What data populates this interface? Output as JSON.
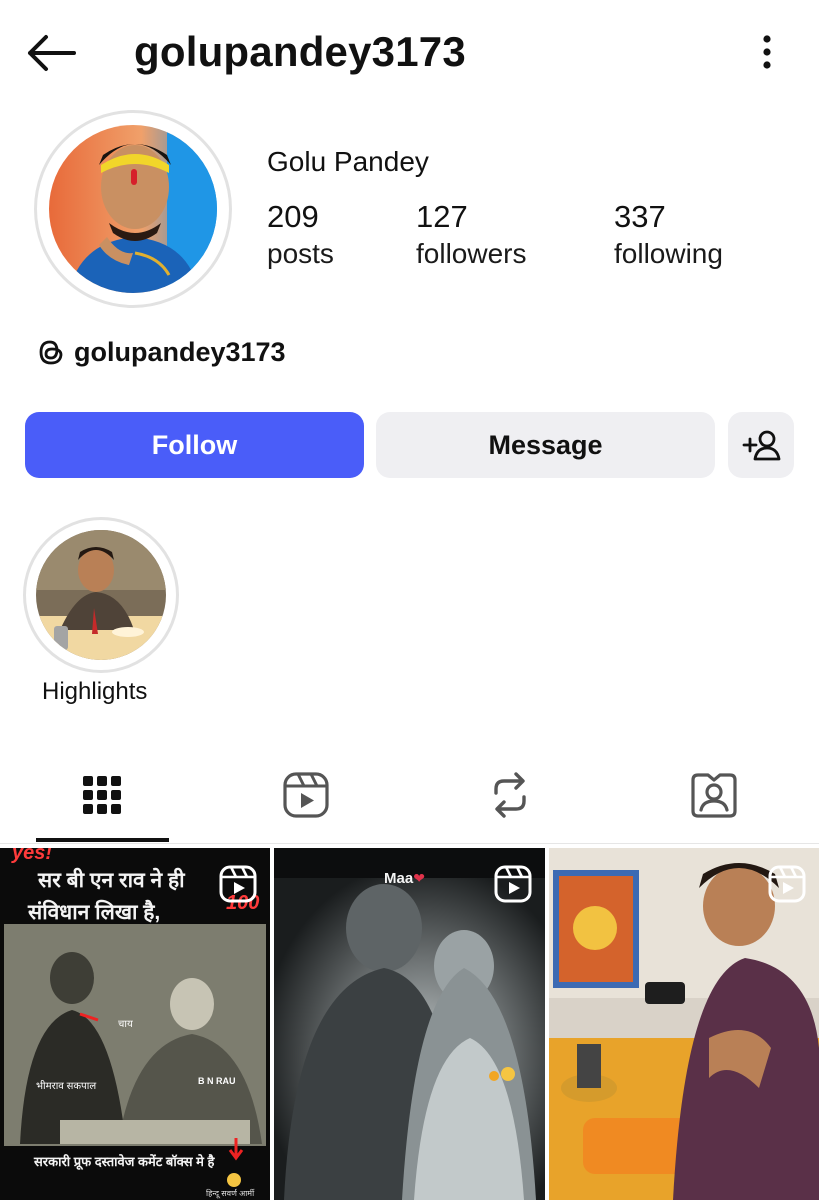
{
  "header": {
    "username": "golupandey3173",
    "back_icon": "arrow-left-icon",
    "more_icon": "vertical-dots-icon"
  },
  "profile": {
    "display_name": "Golu Pandey",
    "stats": {
      "posts": {
        "value": "209",
        "label": "posts"
      },
      "followers": {
        "value": "127",
        "label": "followers"
      },
      "following": {
        "value": "337",
        "label": "following"
      }
    },
    "threads_handle": "golupandey3173"
  },
  "actions": {
    "follow_label": "Follow",
    "message_label": "Message",
    "add_user_icon": "add-person-icon"
  },
  "highlights": [
    {
      "label": "Highlights"
    }
  ],
  "tabs": [
    {
      "icon": "grid-icon",
      "active": true
    },
    {
      "icon": "reels-icon",
      "active": false
    },
    {
      "icon": "reposts-icon",
      "active": false
    },
    {
      "icon": "tagged-icon",
      "active": false
    }
  ],
  "posts": [
    {
      "type": "reel",
      "caption_top_1": "सर बी एन राव ने ही",
      "caption_top_2": "संविधान लिखा है,",
      "corner_tag": "yes!",
      "score_tag": "100",
      "tag_chai": "चाय",
      "tag_name": "भीमराव सकपाल",
      "tag_bnrau": "B N RAU",
      "caption_bottom": "सरकारी प्रूफ दस्तावेज कमेंट बॉक्स मे है",
      "credit": "हिन्दू सवर्ण आर्मी"
    },
    {
      "type": "reel",
      "caption_top": "Maa"
    },
    {
      "type": "reel"
    }
  ],
  "colors": {
    "accent": "#4a5df9",
    "secondary_button": "#efeff2",
    "ring": "#e2e2e2"
  }
}
